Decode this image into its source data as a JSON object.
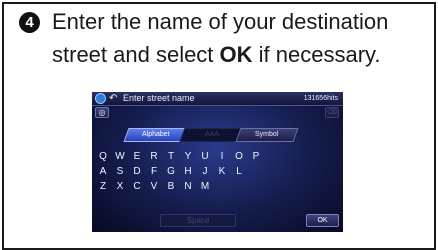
{
  "instruction": {
    "step_number": "4",
    "line1": "Enter the name of your destination",
    "line2_prefix": "street and select ",
    "line2_bold": "OK",
    "line2_suffix": " if necessary."
  },
  "screen": {
    "title": "Enter street name",
    "hit_count": "131656hits",
    "tabs": [
      "Alphabet",
      "AAA",
      "Symbol"
    ],
    "keyboard_rows": [
      [
        "Q",
        "W",
        "E",
        "R",
        "T",
        "Y",
        "U",
        "I",
        "O",
        "P"
      ],
      [
        "A",
        "S",
        "D",
        "F",
        "G",
        "H",
        "J",
        "K",
        "L"
      ],
      [
        "Z",
        "X",
        "C",
        "V",
        "B",
        "N",
        "M"
      ]
    ],
    "space_label": "Space",
    "ok_label": "OK",
    "icons": {
      "nav": "navigation-icon",
      "back": "back-icon",
      "globe": "globe-icon",
      "delete": "delete-icon"
    }
  }
}
